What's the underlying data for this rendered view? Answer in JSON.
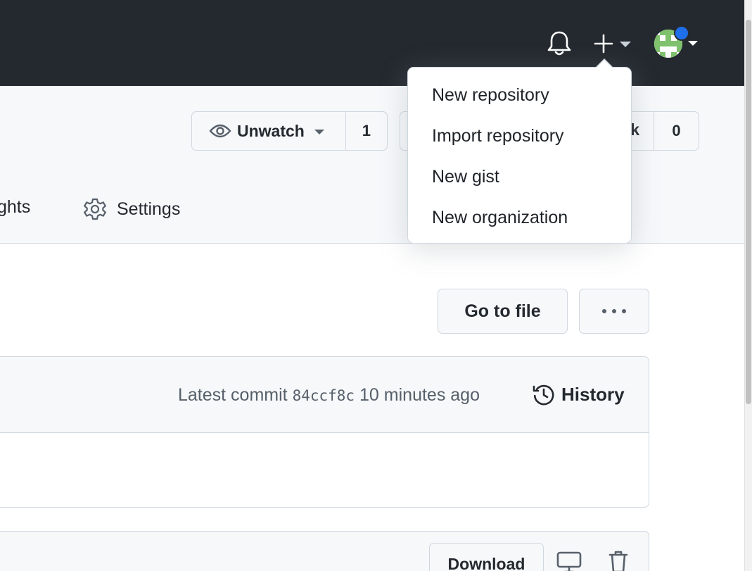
{
  "header": {
    "icons": {
      "notifications": "bell-icon",
      "create": "plus-icon",
      "create_caret": "caret-down-icon",
      "avatar": "avatar-image"
    },
    "colors": {
      "background": "#24292f",
      "avatar_dot": "#1f6feb"
    }
  },
  "create_menu": {
    "items": [
      {
        "label": "New repository"
      },
      {
        "label": "Import repository"
      },
      {
        "label": "New gist"
      },
      {
        "label": "New organization"
      }
    ]
  },
  "repo_actions": {
    "watch_label": "Unwatch",
    "watch_count": "1",
    "fork_label_partial": "k",
    "fork_count": "0"
  },
  "tabs": {
    "insights_partial": "ghts",
    "settings": "Settings"
  },
  "file_actions": {
    "go_to_file": "Go to file",
    "more": "···"
  },
  "commit": {
    "label": "Latest commit",
    "sha": "84ccf8c",
    "time": "10 minutes ago",
    "history_label": "History"
  },
  "file_header": {
    "download_label": "Download"
  }
}
